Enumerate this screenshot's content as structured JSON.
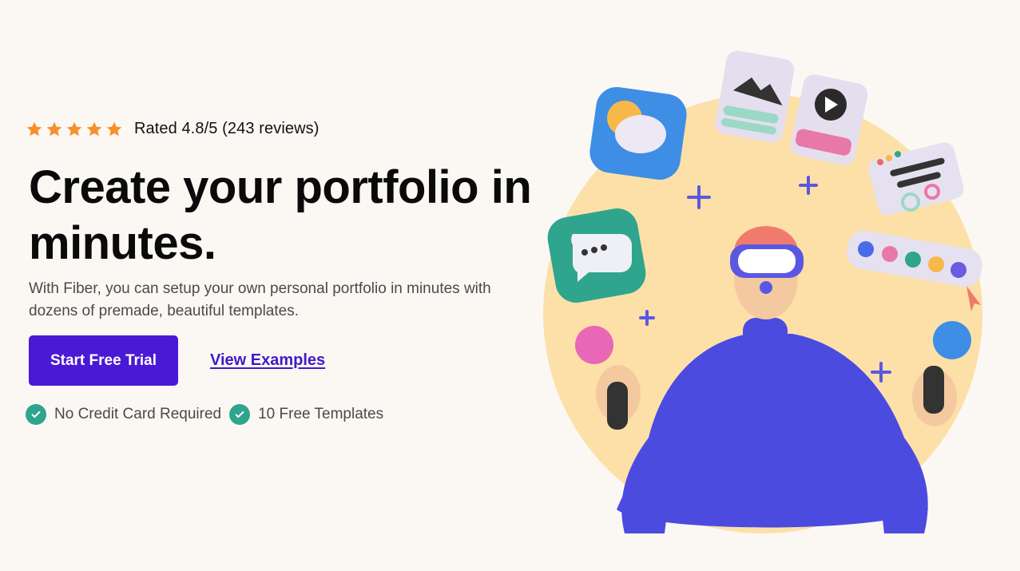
{
  "rating": {
    "stars": 5,
    "star_icon": "star-icon",
    "star_color": "#F7902A",
    "text": "Rated 4.8/5 (243 reviews)"
  },
  "hero": {
    "title": "Create your portfolio in minutes.",
    "subtitle": "With Fiber, you can setup your own personal portfolio in minutes with dozens of premade, beautiful templates."
  },
  "cta": {
    "primary_label": "Start Free Trial",
    "secondary_label": "View Examples",
    "primary_color": "#4A19D6"
  },
  "features": [
    {
      "icon": "check-circle-icon",
      "label": "No Credit Card Required"
    },
    {
      "icon": "check-circle-icon",
      "label": "10 Free Templates"
    }
  ],
  "colors": {
    "background": "#FBF8F4",
    "accent_teal": "#2FA58E",
    "illustration_circle": "#FDE0A8",
    "figure_blue": "#4B4BE0"
  }
}
